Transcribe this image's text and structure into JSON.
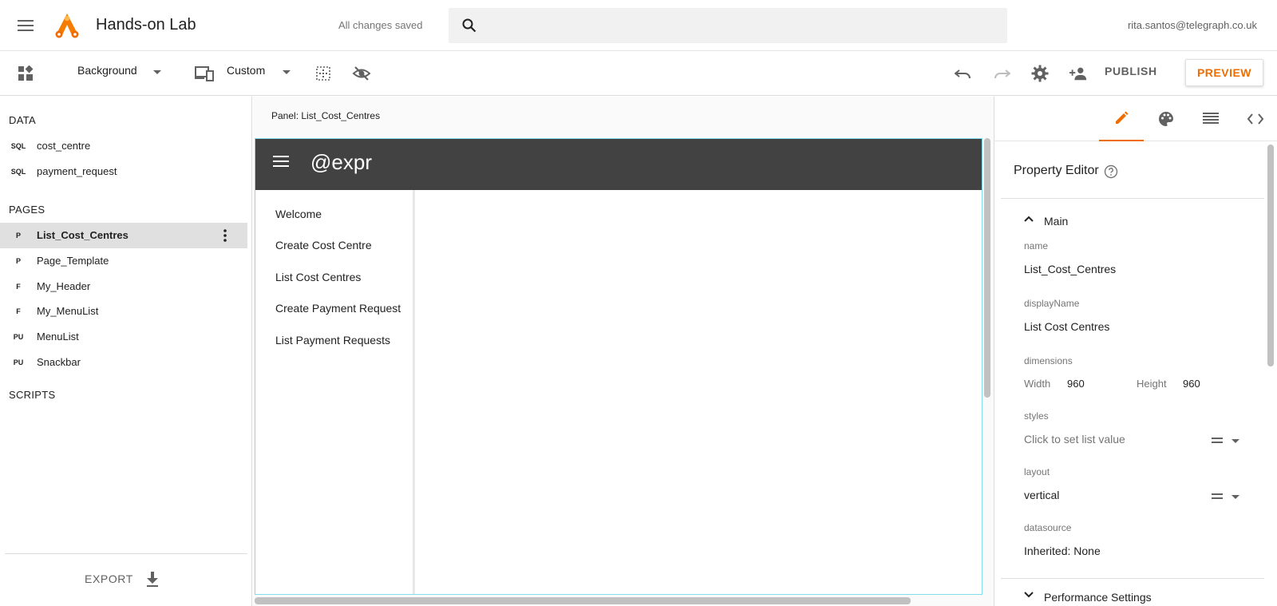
{
  "header": {
    "app_title": "Hands-on Lab",
    "save_status": "All changes saved",
    "search_placeholder": "",
    "user_email": "rita.santos@telegraph.co.uk"
  },
  "toolbar": {
    "layer_select": "Background",
    "device_select": "Custom",
    "publish_label": "PUBLISH",
    "preview_label": "PREVIEW"
  },
  "sidebar": {
    "data_heading": "DATA",
    "data_items": [
      {
        "badge": "SQL",
        "label": "cost_centre"
      },
      {
        "badge": "SQL",
        "label": "payment_request"
      }
    ],
    "pages_heading": "PAGES",
    "page_items": [
      {
        "badge": "P",
        "label": "List_Cost_Centres",
        "selected": true
      },
      {
        "badge": "P",
        "label": "Page_Template"
      },
      {
        "badge": "F",
        "label": "My_Header"
      },
      {
        "badge": "F",
        "label": "My_MenuList"
      },
      {
        "badge": "PU",
        "label": "MenuList"
      },
      {
        "badge": "PU",
        "label": "Snackbar"
      }
    ],
    "scripts_heading": "SCRIPTS",
    "export_label": "EXPORT"
  },
  "canvas": {
    "panel_label": "Panel: List_Cost_Centres",
    "app_header_title": "@expr",
    "nav_items": [
      "Welcome",
      "Create Cost Centre",
      "List Cost Centres",
      "Create Payment Request",
      "List Payment Requests"
    ]
  },
  "property_editor": {
    "title": "Property Editor",
    "main_section": "Main",
    "name_label": "name",
    "name_value": "List_Cost_Centres",
    "display_name_label": "displayName",
    "display_name_value": "List Cost Centres",
    "dimensions_label": "dimensions",
    "width_label": "Width",
    "width_value": "960",
    "height_label": "Height",
    "height_value": "960",
    "styles_label": "styles",
    "styles_placeholder": "Click to set list value",
    "layout_label": "layout",
    "layout_value": "vertical",
    "datasource_label": "datasource",
    "datasource_value": "Inherited: None",
    "performance_section": "Performance Settings"
  },
  "colors": {
    "accent": "#ef6c00",
    "app_header_bg": "#424242",
    "canvas_border": "#80deea"
  }
}
